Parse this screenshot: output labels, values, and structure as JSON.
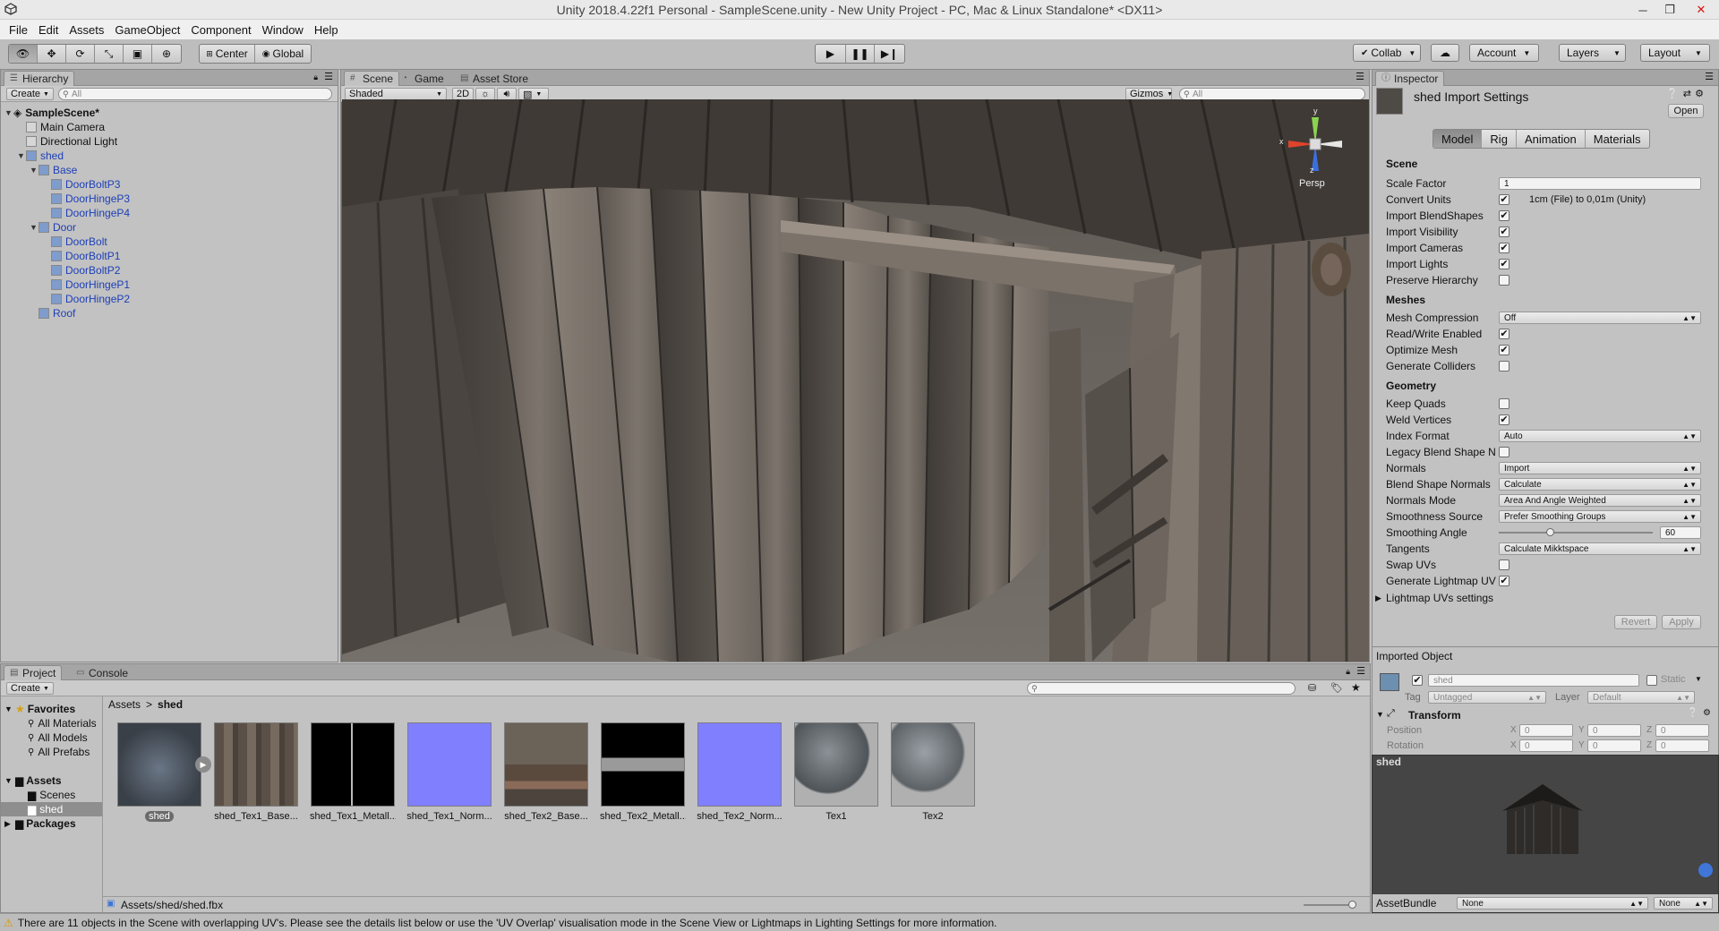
{
  "window": {
    "title": "Unity 2018.4.22f1 Personal - SampleScene.unity - New Unity Project - PC, Mac & Linux Standalone* <DX11>"
  },
  "menu": [
    "File",
    "Edit",
    "Assets",
    "GameObject",
    "Component",
    "Window",
    "Help"
  ],
  "toolbar": {
    "pivot_label": "Center",
    "space_label": "Global",
    "collab_label": "Collab",
    "account_label": "Account",
    "layers_label": "Layers",
    "layout_label": "Layout"
  },
  "hierarchy": {
    "tab": "Hierarchy",
    "create": "Create",
    "search_placeholder": "All",
    "scene_name": "SampleScene*",
    "items": [
      {
        "label": "Main Camera",
        "depth": 1,
        "blue": false,
        "fold": ""
      },
      {
        "label": "Directional Light",
        "depth": 1,
        "blue": false,
        "fold": ""
      },
      {
        "label": "shed",
        "depth": 1,
        "blue": true,
        "fold": "▼"
      },
      {
        "label": "Base",
        "depth": 2,
        "blue": true,
        "fold": "▼"
      },
      {
        "label": "DoorBoltP3",
        "depth": 3,
        "blue": true,
        "fold": ""
      },
      {
        "label": "DoorHingeP3",
        "depth": 3,
        "blue": true,
        "fold": ""
      },
      {
        "label": "DoorHingeP4",
        "depth": 3,
        "blue": true,
        "fold": ""
      },
      {
        "label": "Door",
        "depth": 2,
        "blue": true,
        "fold": "▼"
      },
      {
        "label": "DoorBolt",
        "depth": 3,
        "blue": true,
        "fold": ""
      },
      {
        "label": "DoorBoltP1",
        "depth": 3,
        "blue": true,
        "fold": ""
      },
      {
        "label": "DoorBoltP2",
        "depth": 3,
        "blue": true,
        "fold": ""
      },
      {
        "label": "DoorHingeP1",
        "depth": 3,
        "blue": true,
        "fold": ""
      },
      {
        "label": "DoorHingeP2",
        "depth": 3,
        "blue": true,
        "fold": ""
      },
      {
        "label": "Roof",
        "depth": 2,
        "blue": true,
        "fold": ""
      }
    ]
  },
  "scene": {
    "tabs": [
      "Scene",
      "Game",
      "Asset Store"
    ],
    "shading": "Shaded",
    "mode_2d": "2D",
    "gizmos": "Gizmos",
    "search_placeholder": "All",
    "persp_label": "Persp",
    "axis_x": "x",
    "axis_y": "y",
    "axis_z": "z"
  },
  "inspector": {
    "tab": "Inspector",
    "title": "shed Import Settings",
    "open_button": "Open",
    "tabs": [
      "Model",
      "Rig",
      "Animation",
      "Materials"
    ],
    "active_tab": "Model",
    "sections": {
      "scene": "Scene",
      "meshes": "Meshes",
      "geometry": "Geometry"
    },
    "scene_rows": [
      {
        "label": "Scale Factor",
        "type": "text",
        "value": "1"
      },
      {
        "label": "Convert Units",
        "type": "check",
        "checked": true,
        "note": "1cm (File) to 0,01m (Unity)"
      },
      {
        "label": "Import BlendShapes",
        "type": "check",
        "checked": true
      },
      {
        "label": "Import Visibility",
        "type": "check",
        "checked": true
      },
      {
        "label": "Import Cameras",
        "type": "check",
        "checked": true
      },
      {
        "label": "Import Lights",
        "type": "check",
        "checked": true
      },
      {
        "label": "Preserve Hierarchy",
        "type": "check",
        "checked": false
      }
    ],
    "mesh_rows": [
      {
        "label": "Mesh Compression",
        "type": "drop",
        "value": "Off"
      },
      {
        "label": "Read/Write Enabled",
        "type": "check",
        "checked": true
      },
      {
        "label": "Optimize Mesh",
        "type": "check",
        "checked": true
      },
      {
        "label": "Generate Colliders",
        "type": "check",
        "checked": false
      }
    ],
    "geometry_rows": [
      {
        "label": "Keep Quads",
        "type": "check",
        "checked": false
      },
      {
        "label": "Weld Vertices",
        "type": "check",
        "checked": true
      },
      {
        "label": "Index Format",
        "type": "drop",
        "value": "Auto"
      },
      {
        "label": "Legacy Blend Shape N",
        "type": "check",
        "checked": false
      },
      {
        "label": "Normals",
        "type": "drop",
        "value": "Import"
      },
      {
        "label": "Blend Shape Normals",
        "type": "drop",
        "value": "Calculate"
      },
      {
        "label": "Normals Mode",
        "type": "drop",
        "value": "Area And Angle Weighted"
      },
      {
        "label": "Smoothness Source",
        "type": "drop",
        "value": "Prefer Smoothing Groups"
      },
      {
        "label": "Smoothing Angle",
        "type": "slider",
        "value": "60",
        "fraction": 0.33
      },
      {
        "label": "Tangents",
        "type": "drop",
        "value": "Calculate Mikktspace"
      },
      {
        "label": "Swap UVs",
        "type": "check",
        "checked": false
      },
      {
        "label": "Generate Lightmap UV",
        "type": "check",
        "checked": true
      }
    ],
    "lightmap_foldout": "Lightmap UVs settings",
    "revert": "Revert",
    "apply": "Apply",
    "imported_object": "Imported Object",
    "object_name": "shed",
    "static_label": "Static",
    "tag_label": "Tag",
    "tag_value": "Untagged",
    "layer_label": "Layer",
    "layer_value": "Default",
    "transform": "Transform",
    "position_label": "Position",
    "rotation_label": "Rotation",
    "position": {
      "x": "0",
      "y": "0",
      "z": "0"
    },
    "rotation": {
      "x": "0",
      "y": "0",
      "z": "0"
    },
    "preview_title": "shed",
    "assetbundle_label": "AssetBundle",
    "assetbundle_value": "None",
    "assetbundle_variant": "None"
  },
  "project": {
    "tabs": [
      "Project",
      "Console"
    ],
    "create": "Create",
    "favorites_label": "Favorites",
    "favorites": [
      "All Materials",
      "All Models",
      "All Prefabs"
    ],
    "assets_label": "Assets",
    "assets_children": [
      "Scenes",
      "shed"
    ],
    "packages_label": "Packages",
    "breadcrumb_root": "Assets",
    "breadcrumb_sep": ">",
    "breadcrumb_current": "shed",
    "assets": [
      {
        "name": "shed",
        "kind": "model"
      },
      {
        "name": "shed_Tex1_Base...",
        "kind": "wood"
      },
      {
        "name": "shed_Tex1_Metall...",
        "kind": "black-split"
      },
      {
        "name": "shed_Tex1_Norm...",
        "kind": "normal"
      },
      {
        "name": "shed_Tex2_Base...",
        "kind": "wood2"
      },
      {
        "name": "shed_Tex2_Metall...",
        "kind": "black-band"
      },
      {
        "name": "shed_Tex2_Norm...",
        "kind": "normal"
      },
      {
        "name": "Tex1",
        "kind": "sphere"
      },
      {
        "name": "Tex2",
        "kind": "sphere2"
      }
    ],
    "selected_path": "Assets/shed/shed.fbx"
  },
  "status_message": "There are 11 objects in the Scene with overlapping UV's. Please see the details list below or use the 'UV Overlap' visualisation mode in the Scene View or Lightmaps in Lighting Settings for more information.",
  "colors": {
    "panel": "#c2c2c2",
    "hierarchy_blue": "#1c3fb7",
    "normal_map": "#8080ff",
    "scene_bg": "#6e6761"
  }
}
